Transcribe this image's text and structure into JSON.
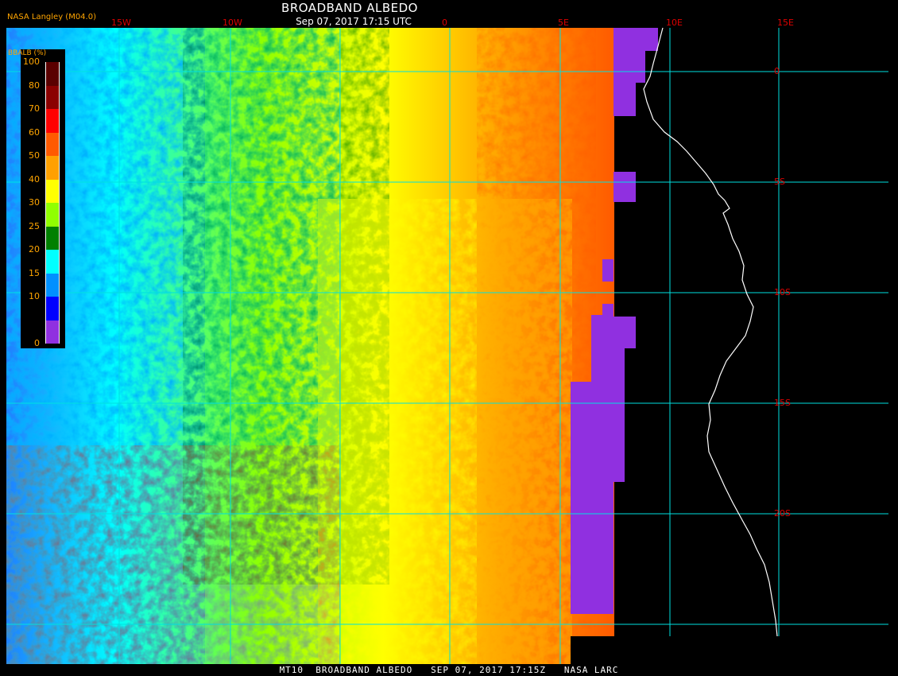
{
  "header": {
    "title": "BROADBAND ALBEDO",
    "timestamp": "Sep 07, 2017 17:15 UTC",
    "producer": "NASA Langley (M04.0)"
  },
  "footer": "MT10  BROADBAND ALBEDO   SEP 07, 2017 17:15Z   NASA LARC",
  "legend": {
    "title": "BBALB (%)",
    "labels": [
      "100",
      "80",
      "70",
      "60",
      "50",
      "40",
      "30",
      "25",
      "20",
      "15",
      "10",
      "0"
    ],
    "colors": [
      "#5a0000",
      "#8b0000",
      "#ff0000",
      "#ff5a00",
      "#ffa000",
      "#ffff00",
      "#90ff00",
      "#008000",
      "#00ffff",
      "#0090ff",
      "#0000ff",
      "#9030e0"
    ]
  },
  "grid": {
    "lon_labels": [
      "15W",
      "10W",
      "0",
      "5E",
      "10E",
      "15E"
    ],
    "lat_labels": [
      "0",
      "5S",
      "10S",
      "15S",
      "20S"
    ]
  },
  "colors": {
    "grid_line": "#00e0e0",
    "tick_label": "#dd0000",
    "coast": "#ffffff",
    "no_data": "#9030e0"
  }
}
